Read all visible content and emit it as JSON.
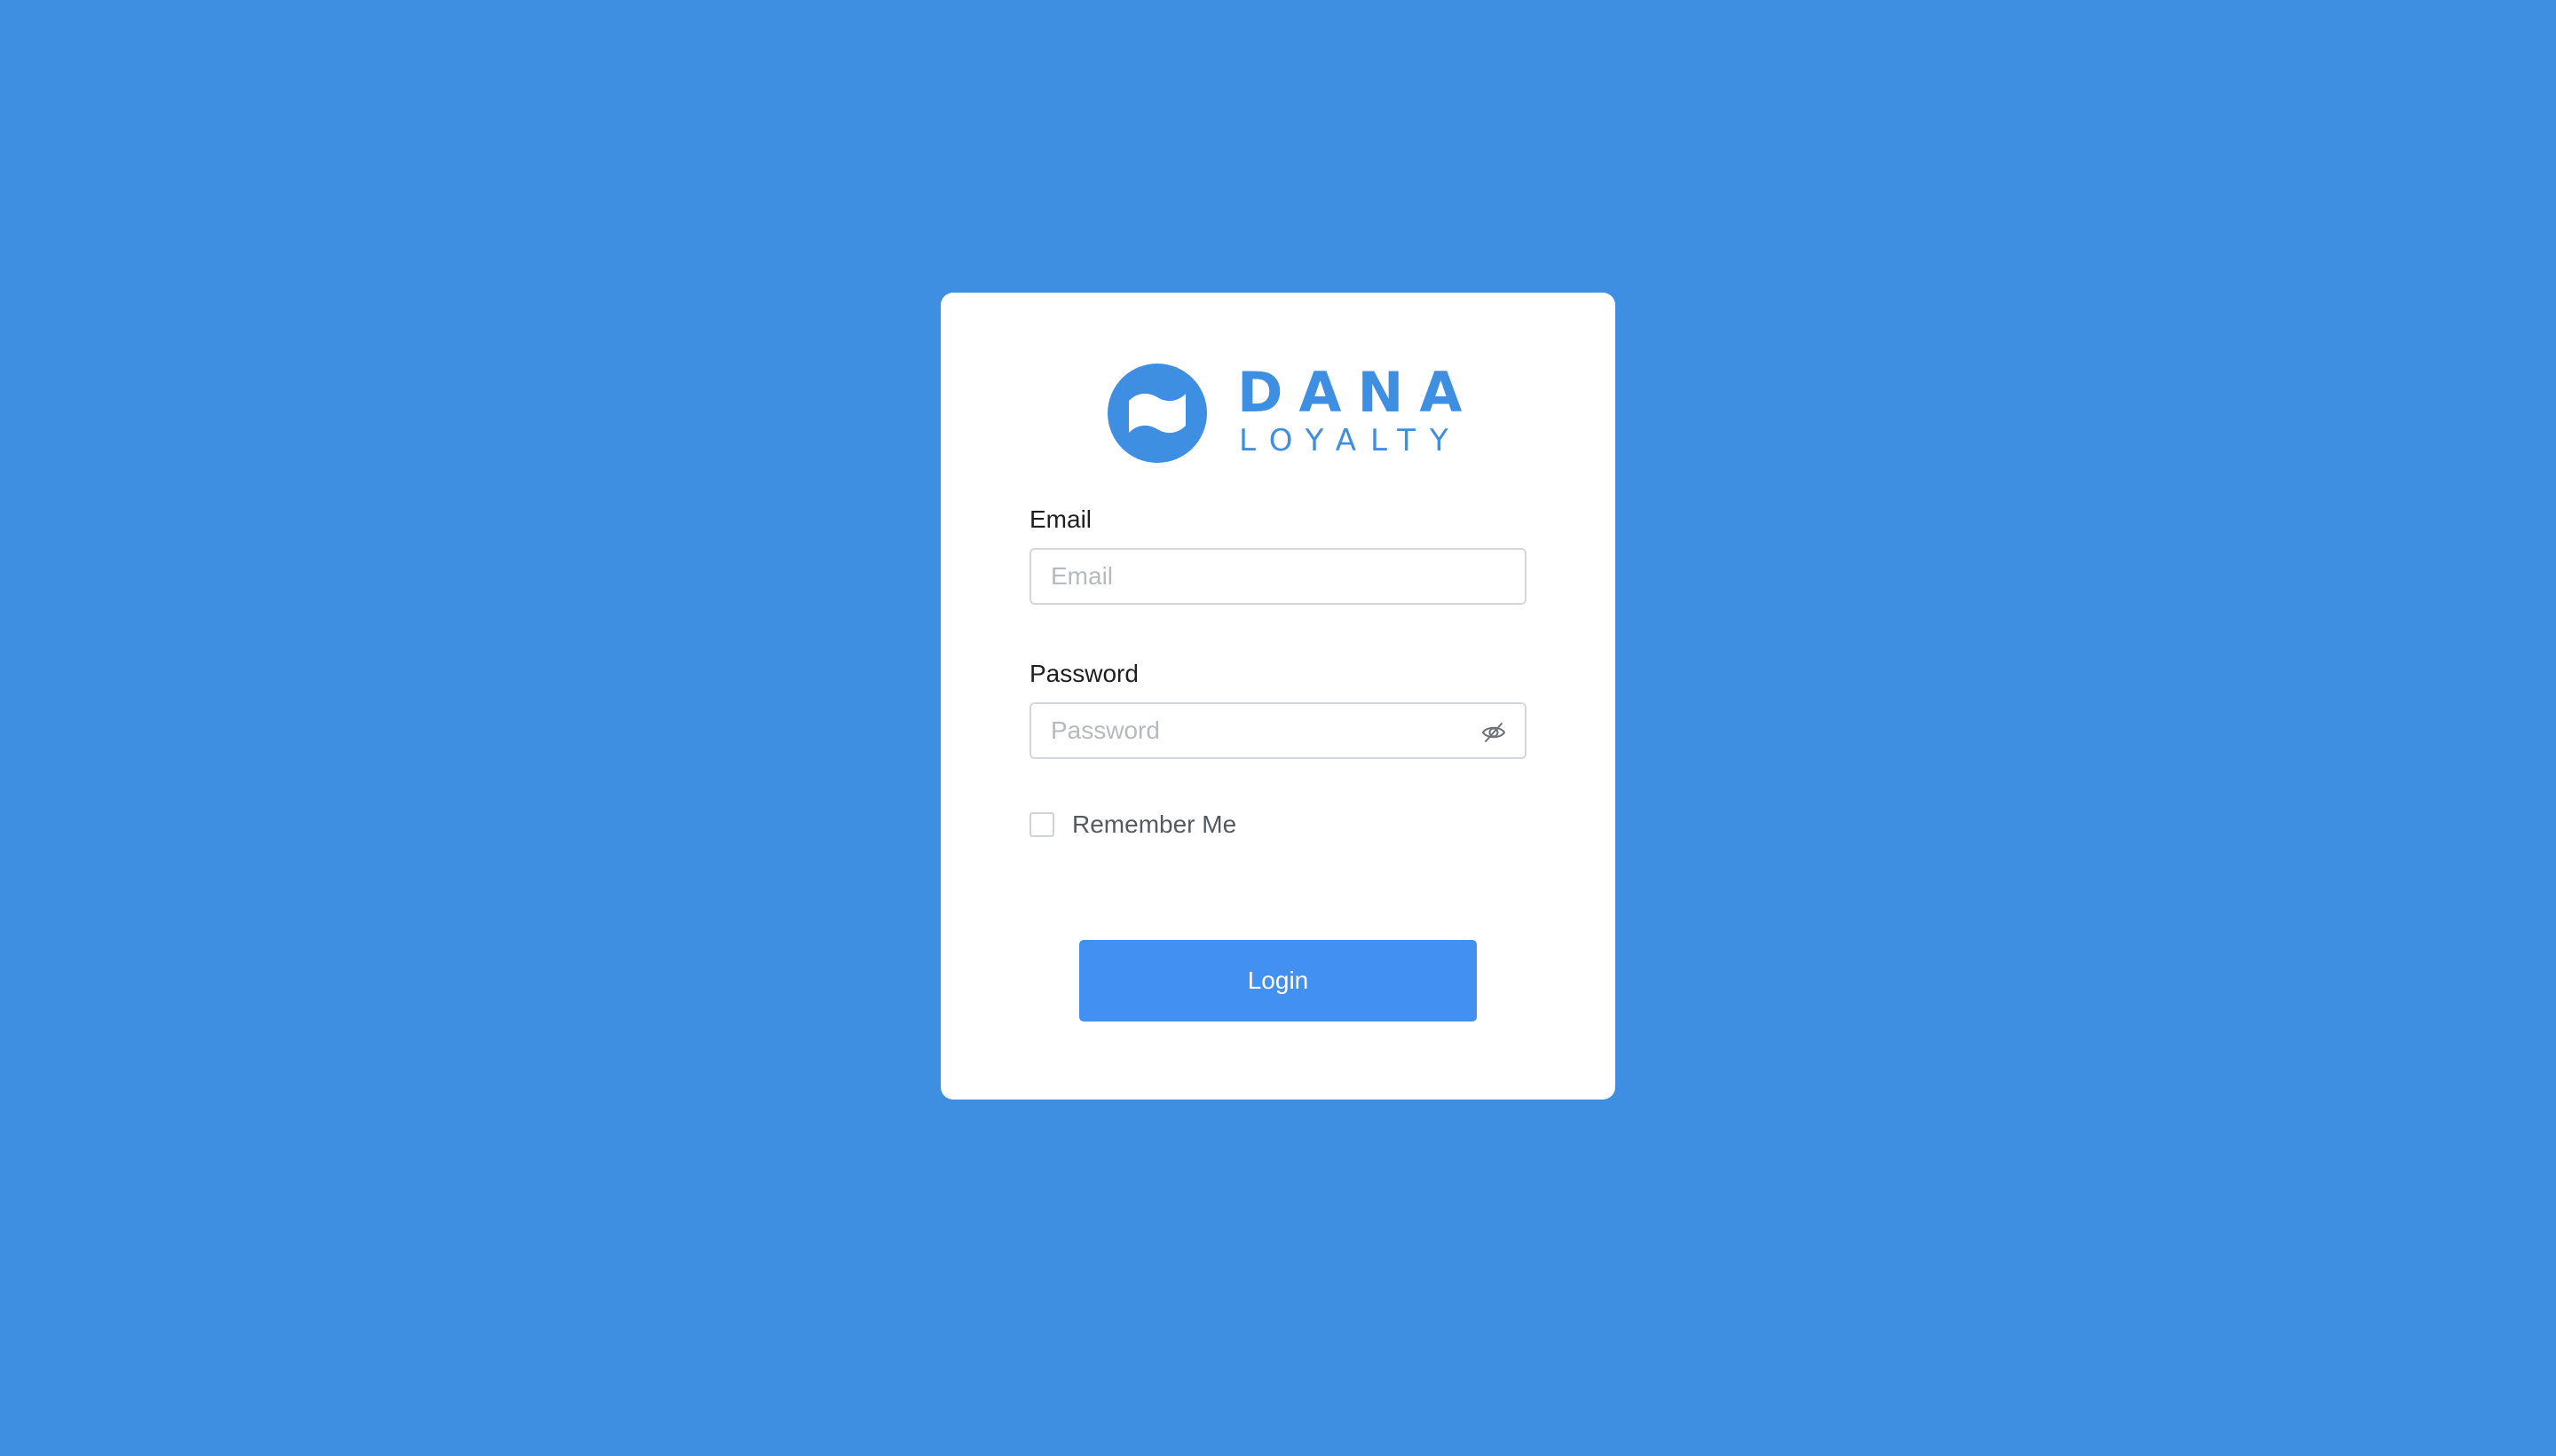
{
  "brand": {
    "name": "DANA",
    "tagline": "LOYALTY",
    "logo_icon": "flag-circle-icon",
    "color": "#3e8fe1"
  },
  "background_color": "#3e8fe1",
  "form": {
    "email": {
      "label": "Email",
      "placeholder": "Email",
      "value": ""
    },
    "password": {
      "label": "Password",
      "placeholder": "Password",
      "value": "",
      "toggle_icon": "eye-off-icon"
    },
    "remember_me": {
      "label": "Remember Me",
      "checked": false
    },
    "login_button": {
      "label": "Login",
      "color": "#4190f2"
    }
  }
}
